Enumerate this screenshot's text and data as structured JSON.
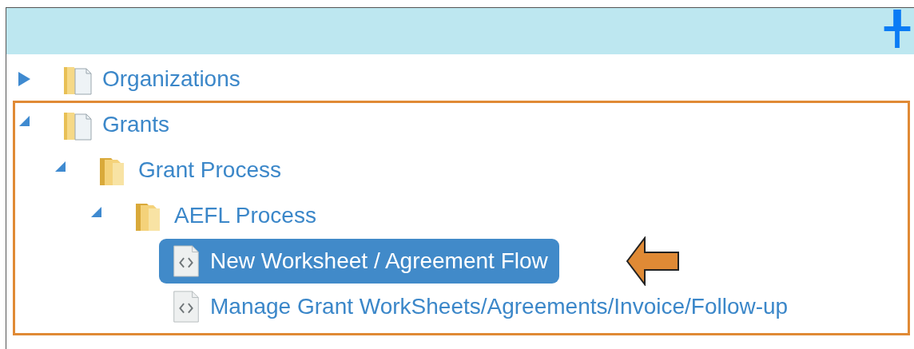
{
  "tree": [
    {
      "label": "Organizations",
      "kind": "root-folder",
      "expanded": false,
      "selected": false
    },
    {
      "label": "Grants",
      "kind": "root-folder",
      "expanded": true,
      "selected": false,
      "children": [
        {
          "label": "Grant Process",
          "kind": "folder",
          "expanded": true,
          "selected": false,
          "children": [
            {
              "label": "AEFL Process",
              "kind": "folder",
              "expanded": true,
              "selected": false,
              "children": [
                {
                  "label": "New Worksheet / Agreement Flow",
                  "kind": "page",
                  "selected": true
                },
                {
                  "label": "Manage Grant WorkSheets/Agreements/Invoice/Follow-up",
                  "kind": "page",
                  "selected": false
                }
              ]
            }
          ]
        }
      ]
    }
  ]
}
